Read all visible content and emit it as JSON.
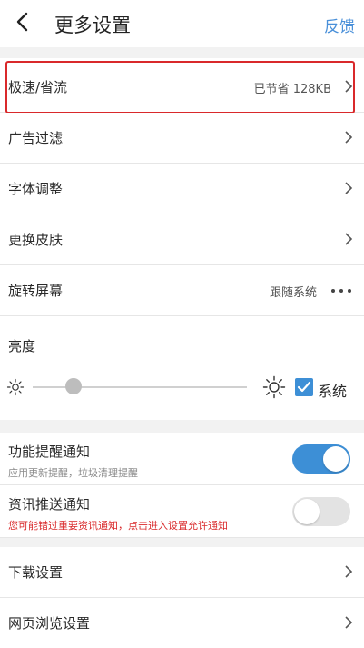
{
  "header": {
    "title": "更多设置",
    "feedback_label": "反馈"
  },
  "settings": {
    "speed": {
      "label": "极速/省流",
      "value": "已节省 128KB"
    },
    "adblock": {
      "label": "广告过滤"
    },
    "font": {
      "label": "字体调整"
    },
    "skin": {
      "label": "更换皮肤"
    },
    "rotate": {
      "label": "旋转屏幕",
      "value": "跟随系统"
    }
  },
  "brightness": {
    "label": "亮度",
    "level": 0.19,
    "system_label": "系统",
    "system_checked": true
  },
  "notifications": {
    "feature": {
      "title": "功能提醒通知",
      "subtitle": "应用更新提醒，垃圾清理提醒",
      "enabled": true
    },
    "news": {
      "title": "资讯推送通知",
      "subtitle": "您可能错过重要资讯通知，点击进入设置允许通知",
      "enabled": false
    }
  },
  "more": {
    "download": {
      "label": "下载设置"
    },
    "browse": {
      "label": "网页浏览设置"
    }
  },
  "colors": {
    "accent": "#3d8fd6",
    "warning": "#d9292b"
  }
}
